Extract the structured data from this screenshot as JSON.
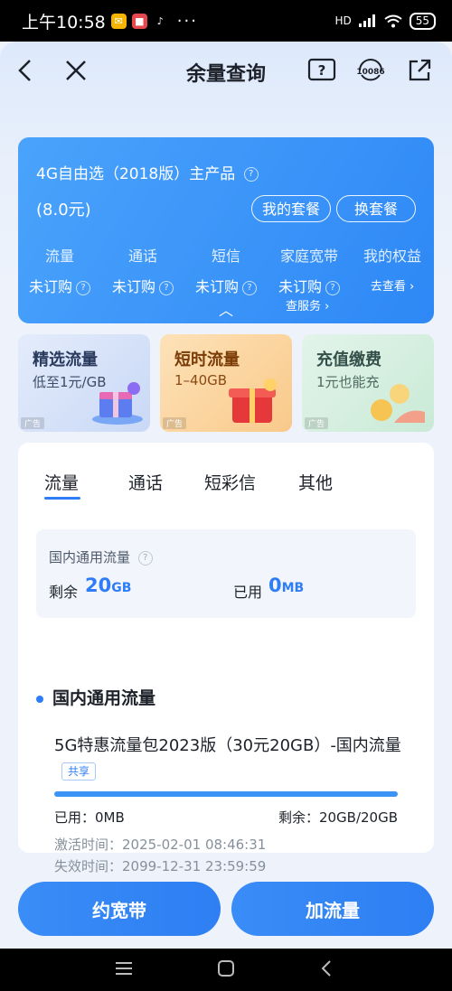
{
  "status_bar": {
    "time": "上午10:58",
    "battery": "55",
    "network": "HD"
  },
  "header": {
    "title": "余量查询"
  },
  "plan": {
    "name": "4G自由选（2018版）主产品",
    "price": "(8.0元)",
    "my_plan_button": "我的套餐",
    "change_plan_button": "换套餐",
    "services": [
      {
        "label": "流量",
        "status": "未订购"
      },
      {
        "label": "通话",
        "status": "未订购"
      },
      {
        "label": "短信",
        "status": "未订购"
      },
      {
        "label": "家庭宽带",
        "status": "未订购"
      },
      {
        "label": "我的权益",
        "status": "去查看 ›"
      }
    ],
    "check_services": "查服务 ›"
  },
  "promos": [
    {
      "title": "精选流量",
      "subtitle": "低至1元/GB",
      "ad": "广告"
    },
    {
      "title": "短时流量",
      "subtitle": "1–40GB",
      "ad": "广告"
    },
    {
      "title": "充值缴费",
      "subtitle": "1元也能充",
      "ad": "广告"
    }
  ],
  "tabs": [
    "流量",
    "通话",
    "短彩信",
    "其他"
  ],
  "summary": {
    "title": "国内通用流量",
    "remaining_label": "剩余",
    "remaining_value": "20",
    "remaining_unit": "GB",
    "used_label": "已用",
    "used_value": "0",
    "used_unit": "MB"
  },
  "section": {
    "title": "国内通用流量",
    "package_name": "5G特惠流量包2023版（30元20GB）-国内流量",
    "shared_badge": "共享",
    "remaining_fraction": 1.0,
    "used_text": "已用：0MB",
    "remaining_text": "剩余：20GB/20GB",
    "activation": "激活时间：2025-02-01 08:46:31",
    "expiration": "失效时间：2099-12-31 23:59:59"
  },
  "buttons": {
    "broadband": "约宽带",
    "add_data": "加流量"
  },
  "colors": {
    "accent": "#2f7df6",
    "card": "#3b93f7"
  }
}
